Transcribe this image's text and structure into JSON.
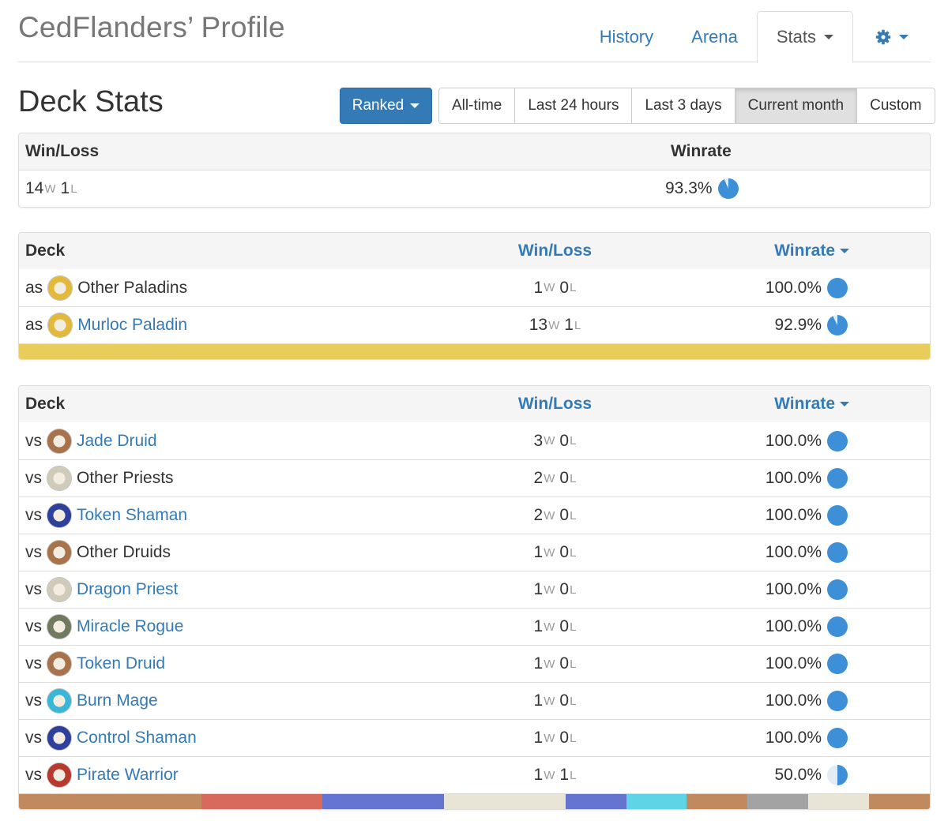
{
  "header": {
    "title": "CedFlanders’ Profile",
    "nav": [
      {
        "label": "History",
        "active": false
      },
      {
        "label": "Arena",
        "active": false
      },
      {
        "label": "Stats",
        "active": true
      }
    ],
    "settings_icon": "gear-icon"
  },
  "deck_stats": {
    "title": "Deck Stats",
    "mode_button": "Ranked",
    "time_filters": [
      {
        "label": "All-time",
        "active": false
      },
      {
        "label": "Last 24 hours",
        "active": false
      },
      {
        "label": "Last 3 days",
        "active": false
      },
      {
        "label": "Current month",
        "active": true
      },
      {
        "label": "Custom",
        "active": false
      }
    ]
  },
  "summary": {
    "headers": {
      "winloss": "Win/Loss",
      "winrate": "Winrate"
    },
    "wins": "14",
    "losses": "1",
    "w_suffix": "W",
    "l_suffix": "L",
    "winrate": "93.3%",
    "winrate_value": 0.933
  },
  "own_decks": {
    "headers": {
      "deck": "Deck",
      "winloss": "Win/Loss",
      "winrate": "Winrate"
    },
    "rows": [
      {
        "prefix": "as",
        "name": "Other Paladins",
        "is_link": false,
        "icon_color": "#e2b93b",
        "wins": "1",
        "losses": "0",
        "winrate": "100.0%",
        "winrate_value": 1.0
      },
      {
        "prefix": "as",
        "name": "Murloc Paladin",
        "is_link": true,
        "icon_color": "#e2b93b",
        "wins": "13",
        "losses": "1",
        "winrate": "92.9%",
        "winrate_value": 0.929
      }
    ],
    "bar": [
      {
        "color": "#e8cd5a",
        "share": 1.0
      }
    ]
  },
  "opponent_decks": {
    "headers": {
      "deck": "Deck",
      "winloss": "Win/Loss",
      "winrate": "Winrate"
    },
    "rows": [
      {
        "prefix": "vs",
        "name": "Jade Druid",
        "is_link": true,
        "icon_color": "#a8734a",
        "wins": "3",
        "losses": "0",
        "winrate": "100.0%",
        "winrate_value": 1.0
      },
      {
        "prefix": "vs",
        "name": "Other Priests",
        "is_link": false,
        "icon_color": "#cfcbb8",
        "wins": "2",
        "losses": "0",
        "winrate": "100.0%",
        "winrate_value": 1.0
      },
      {
        "prefix": "vs",
        "name": "Token Shaman",
        "is_link": true,
        "icon_color": "#2f3f9c",
        "wins": "2",
        "losses": "0",
        "winrate": "100.0%",
        "winrate_value": 1.0
      },
      {
        "prefix": "vs",
        "name": "Other Druids",
        "is_link": false,
        "icon_color": "#a8734a",
        "wins": "1",
        "losses": "0",
        "winrate": "100.0%",
        "winrate_value": 1.0
      },
      {
        "prefix": "vs",
        "name": "Dragon Priest",
        "is_link": true,
        "icon_color": "#cfcbb8",
        "wins": "1",
        "losses": "0",
        "winrate": "100.0%",
        "winrate_value": 1.0
      },
      {
        "prefix": "vs",
        "name": "Miracle Rogue",
        "is_link": true,
        "icon_color": "#6f7a5e",
        "wins": "1",
        "losses": "0",
        "winrate": "100.0%",
        "winrate_value": 1.0
      },
      {
        "prefix": "vs",
        "name": "Token Druid",
        "is_link": true,
        "icon_color": "#a8734a",
        "wins": "1",
        "losses": "0",
        "winrate": "100.0%",
        "winrate_value": 1.0
      },
      {
        "prefix": "vs",
        "name": "Burn Mage",
        "is_link": true,
        "icon_color": "#3ab7d8",
        "wins": "1",
        "losses": "0",
        "winrate": "100.0%",
        "winrate_value": 1.0
      },
      {
        "prefix": "vs",
        "name": "Control Shaman",
        "is_link": true,
        "icon_color": "#2f3f9c",
        "wins": "1",
        "losses": "0",
        "winrate": "100.0%",
        "winrate_value": 1.0
      },
      {
        "prefix": "vs",
        "name": "Pirate Warrior",
        "is_link": true,
        "icon_color": "#b83a2e",
        "wins": "1",
        "losses": "1",
        "winrate": "50.0%",
        "winrate_value": 0.5
      }
    ],
    "bar": [
      {
        "color": "#c18a5e",
        "share": 0.2
      },
      {
        "color": "#d76a5c",
        "share": 0.1333
      },
      {
        "color": "#6574d0",
        "share": 0.1333
      },
      {
        "color": "#e8e4d6",
        "share": 0.1333
      },
      {
        "color": "#6574d0",
        "share": 0.0667
      },
      {
        "color": "#5fd4e6",
        "share": 0.0667
      },
      {
        "color": "#c18a5e",
        "share": 0.0667
      },
      {
        "color": "#a3a3a3",
        "share": 0.0667
      },
      {
        "color": "#e8e4d6",
        "share": 0.0667
      },
      {
        "color": "#c18a5e",
        "share": 0.0666
      }
    ]
  },
  "colors": {
    "link": "#337ab7",
    "pie_fill": "#3d8fd8",
    "pie_empty": "#e3ecf5"
  }
}
